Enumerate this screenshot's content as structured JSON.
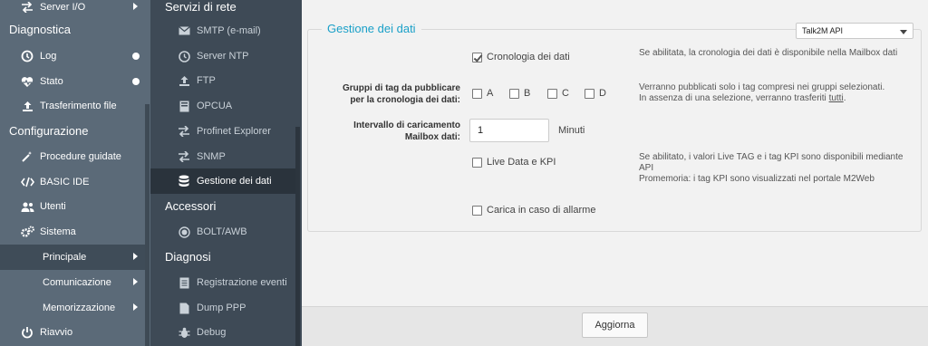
{
  "sidebar": {
    "top_item": "Server I/O",
    "diagnostica": {
      "title": "Diagnostica",
      "items": [
        {
          "label": "Log",
          "icon": "history-icon"
        },
        {
          "label": "Stato",
          "icon": "heartbeat-icon"
        },
        {
          "label": "Trasferimento file",
          "icon": "upload-icon"
        }
      ]
    },
    "configurazione": {
      "title": "Configurazione",
      "items": [
        {
          "label": "Procedure guidate",
          "icon": "magic-wand-icon"
        },
        {
          "label": "BASIC IDE",
          "icon": "code-icon"
        },
        {
          "label": "Utenti",
          "icon": "users-icon"
        },
        {
          "label": "Sistema",
          "icon": "cogs-icon"
        }
      ],
      "sub_items": [
        {
          "label": "Principale"
        },
        {
          "label": "Comunicazione"
        },
        {
          "label": "Memorizzazione"
        }
      ]
    },
    "riavvio": "Riavvio"
  },
  "sidebar2": {
    "servizi_title": "Servizi di rete",
    "servizi": [
      {
        "label": "SMTP (e-mail)",
        "icon": "envelope-icon"
      },
      {
        "label": "Server NTP",
        "icon": "clock-icon"
      },
      {
        "label": "FTP",
        "icon": "upload-icon"
      },
      {
        "label": "OPCUA",
        "icon": "server-icon"
      },
      {
        "label": "Profinet Explorer",
        "icon": "exchange-icon"
      },
      {
        "label": "SNMP",
        "icon": "exchange-icon"
      },
      {
        "label": "Gestione dei dati",
        "icon": "database-icon"
      }
    ],
    "accessori_title": "Accessori",
    "accessori": [
      {
        "label": "BOLT/AWB",
        "icon": "target-icon"
      }
    ],
    "diagnosi_title": "Diagnosi",
    "diagnosi": [
      {
        "label": "Registrazione eventi",
        "icon": "list-icon"
      },
      {
        "label": "Dump PPP",
        "icon": "file-icon"
      },
      {
        "label": "Debug",
        "icon": "bug-icon"
      }
    ]
  },
  "main": {
    "legend": "Gestione dei dati",
    "select_value": "Talk2M API",
    "cronologia_label": "Cronologia dei dati",
    "cronologia_checked": true,
    "cronologia_help": "Se abilitata, la cronologia dei dati è disponibile nella Mailbox dati",
    "gruppi_label": "Gruppi di tag da pubblicare per la cronologia dei dati:",
    "gruppi": [
      "A",
      "B",
      "C",
      "D"
    ],
    "gruppi_help_1": "Verranno pubblicati solo i tag compresi nei gruppi selezionati.",
    "gruppi_help_2": "In assenza di una selezione, verranno trasferiti ",
    "gruppi_help_link": "tutti",
    "gruppi_help_end": ".",
    "intervallo_label": "Intervallo di caricamento Mailbox dati:",
    "intervallo_value": "1",
    "intervallo_unit": "Minuti",
    "live_label": "Live Data e KPI",
    "live_checked": false,
    "live_help_1": "Se abilitato, i valori Live TAG e i tag KPI sono disponibili mediante API",
    "live_help_2": "Promemoria: i tag KPI sono visualizzati nel portale M2Web",
    "allarme_label": "Carica in caso di allarme",
    "allarme_checked": false,
    "update_button": "Aggiorna"
  }
}
